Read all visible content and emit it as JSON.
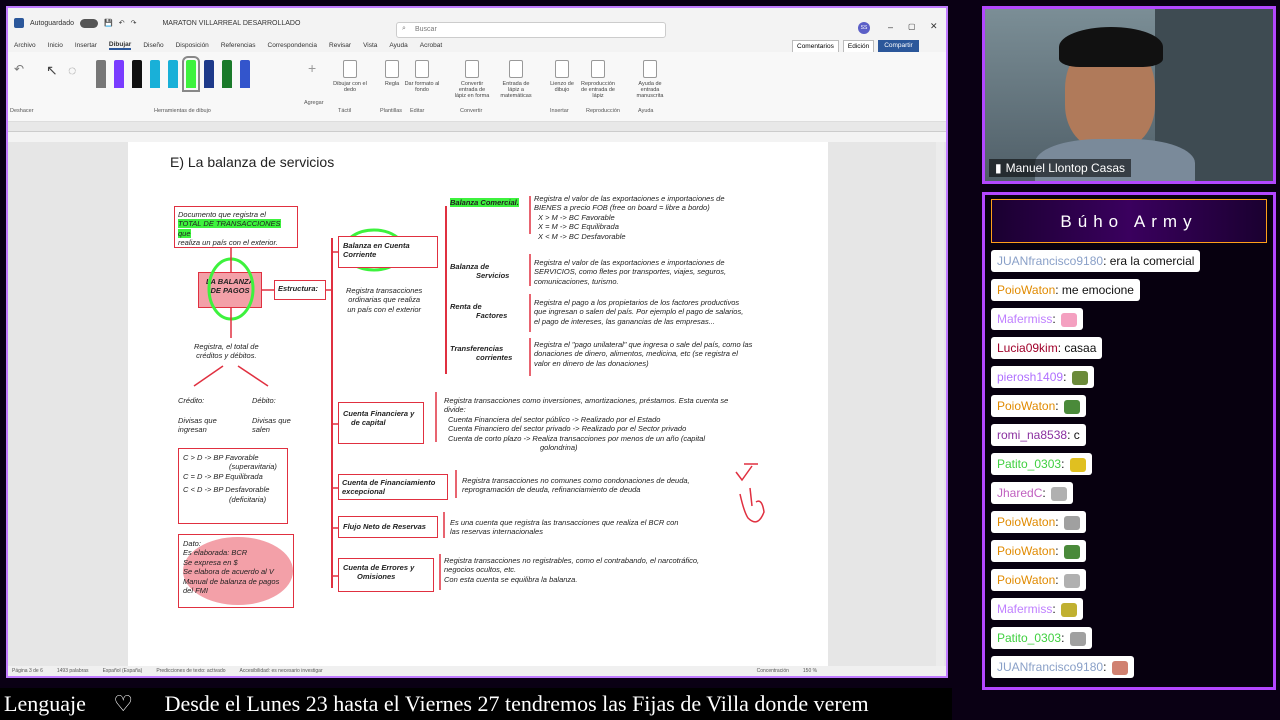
{
  "word": {
    "autosave": "Autoguardado",
    "doc_title": "MARATON VILLARREAL DESARROLLADO",
    "search_placeholder": "Buscar",
    "user_initials": "SS",
    "menu": [
      "Archivo",
      "Inicio",
      "Insertar",
      "Dibujar",
      "Diseño",
      "Disposición",
      "Referencias",
      "Correspondencia",
      "Revisar",
      "Vista",
      "Ayuda",
      "Acrobat"
    ],
    "active_menu": "Dibujar",
    "comments_btn": "Comentarios",
    "edit_btn": "Edición",
    "share_btn": "Compartir",
    "undo_label": "Deshacer",
    "draw_tools_label": "Herramientas de dibujo",
    "add_label": "Agregar",
    "ribbon_buttons": [
      {
        "label": "Dibujar con el dedo",
        "group": "Táctil"
      },
      {
        "label": "Regla",
        "group": "Plantillas"
      },
      {
        "label": "Dar formato al fondo",
        "group": "Editar"
      },
      {
        "label": "Convertir entrada de lápiz en forma",
        "group": "Convertir"
      },
      {
        "label": "Entrada de lápiz a matemáticas",
        "group": ""
      },
      {
        "label": "Lienzo de dibujo",
        "group": "Insertar"
      },
      {
        "label": "Reproducción de entrada de lápiz",
        "group": "Reproducción"
      },
      {
        "label": "Ayuda de entrada manuscrita",
        "group": "Ayuda"
      }
    ],
    "pen_colors": [
      "#777777",
      "#7a3cff",
      "#111111",
      "#19b0d8",
      "#19b0d8",
      "#3df23d",
      "#1e3a8a",
      "#1a7a2a",
      "#3355cc"
    ],
    "status": [
      "Página 3 de 6",
      "1493 palabras",
      "Español (España)",
      "Predicciones de texto: activado",
      "Accesibilidad: es necesario investigar",
      "Concentración",
      "150 %"
    ]
  },
  "doc": {
    "heading": "E) La balanza de servicios",
    "def_box": [
      "Documento que registra el",
      "TOTAL DE TRANSACCIONES que",
      "realiza un país con el exterior."
    ],
    "lbp": [
      "LA BALANZA",
      "DE PAGOS"
    ],
    "estructura": "Estructura:",
    "registra": [
      "Registra, el total de",
      "créditos y débitos."
    ],
    "credito": "Crédito:",
    "debito": "Débito:",
    "divisas_in": [
      "Divisas que",
      "ingresan"
    ],
    "divisas_out": [
      "Divisas que",
      "salen"
    ],
    "cd_rules": [
      "C > D  -> BP Favorable",
      "(superavitaria)",
      "C = D  -> BP Equilibrada",
      "C < D  -> BP Desfavorable",
      "(deficitaria)"
    ],
    "dato": [
      "Dato:",
      "Es elaborada: BCR",
      "Se expresa en $",
      "Se elabora de acuerdo al V",
      "Manual  de balanza de pagos",
      "del FMI"
    ],
    "bcc": [
      "Balanza en Cuenta",
      "Corriente"
    ],
    "bcc_desc": [
      "Registra transacciones",
      "ordinarias que realiza",
      "un país con el exterior"
    ],
    "rows": [
      {
        "label": [
          "Balanza Comercial."
        ],
        "text": [
          "Registra el valor de las exportaciones e importaciones de",
          "BIENES a precio FOB (free on board = libre a bordo)",
          "X  >  M -> BC Favorable",
          "X  =  M -> BC Equilibrada",
          "X  <  M -> BC Desfavorable"
        ]
      },
      {
        "label": [
          "Balanza de",
          "Servicios"
        ],
        "text": [
          "Registra el valor de las exportaciones e importaciones de",
          "SERVICIOS, como fletes por transportes, viajes, seguros,",
          "comunicaciones, turismo."
        ]
      },
      {
        "label": [
          "Renta de",
          "Factores"
        ],
        "text": [
          "Registra el pago a los propietarios de los factores productivos",
          "que ingresan o salen del país. Por ejemplo el pago de salarios,",
          "el pago de intereses, las ganancias de las empresas..."
        ]
      },
      {
        "label": [
          "Transferencias",
          "corrientes"
        ],
        "text": [
          "Registra el \"pago unilateral\" que ingresa o sale del país, como las",
          "donaciones de dinero, alimentos, medicina, etc (se registra el",
          "valor en dinero de las donaciones)"
        ]
      }
    ],
    "cf": [
      "Cuenta Financiera y",
      "de capital"
    ],
    "cf_text": [
      "Registra transacciones como inversiones, amortizaciones, préstamos. Esta cuenta se",
      "divide:",
      "Cuenta Financiera del sector público -> Realizado por el Estado",
      "Cuenta Financiero del sector privado -> Realizado por el Sector privado",
      "Cuenta de corto plazo -> Realiza transacciones por menos de un año (capital",
      "golondrina)"
    ],
    "cfe": [
      "Cuenta de Financiamiento",
      "excepcional"
    ],
    "cfe_text": [
      "Registra transacciones no comunes como condonaciones de deuda,",
      "reprogramación de deuda, refinanciamiento de deuda"
    ],
    "fnr": "Flujo Neto de Reservas",
    "fnr_text": [
      "Es  una cuenta que registra las transacciones que realiza el BCR con",
      "las reservas internacionales"
    ],
    "ceo": [
      "Cuenta de Errores y",
      "Omisiones"
    ],
    "ceo_text": [
      "Registra transacciones no registrables, como el contrabando, el narcotráfico,",
      "negocios ocultos, etc.",
      "Con esta cuenta se equilibra la balanza."
    ]
  },
  "camera": {
    "name": "Manuel Llontop Casas"
  },
  "chat": {
    "title": "Búho Army",
    "messages": [
      {
        "user": "JUANfrancisco9180",
        "color": "#8aa0c8",
        "text": ": era la comercial",
        "emote": ""
      },
      {
        "user": "PoioWaton",
        "color": "#e08a00",
        "text": ": me emocione",
        "emote": ""
      },
      {
        "user": "Mafermiss",
        "color": "#c080ff",
        "text": ": ",
        "emote": "#f4a0c0"
      },
      {
        "user": "Lucia09kim",
        "color": "#a0002a",
        "text": ": casaa",
        "emote": ""
      },
      {
        "user": "pierosh1409",
        "color": "#b070ff",
        "text": ": ",
        "emote": "#6b8a3a"
      },
      {
        "user": "PoioWaton",
        "color": "#e08a00",
        "text": ": ",
        "emote": "#4a8a3a"
      },
      {
        "user": "romi_na8538",
        "color": "#8a2fa0",
        "text": ": c",
        "emote": ""
      },
      {
        "user": "Patito_0303",
        "color": "#40d040",
        "text": ": ",
        "emote": "#e0c020"
      },
      {
        "user": "JharedC",
        "color": "#c060c0",
        "text": ": ",
        "emote": "#b0b0b0"
      },
      {
        "user": "PoioWaton",
        "color": "#e08a00",
        "text": ": ",
        "emote": "#a0a0a0"
      },
      {
        "user": "PoioWaton",
        "color": "#e08a00",
        "text": ": ",
        "emote": "#4a8a3a"
      },
      {
        "user": "PoioWaton",
        "color": "#e08a00",
        "text": ": ",
        "emote": "#b0b0b0"
      },
      {
        "user": "Mafermiss",
        "color": "#c080ff",
        "text": ": ",
        "emote": "#c0b030"
      },
      {
        "user": "Patito_0303",
        "color": "#40d040",
        "text": ": ",
        "emote": "#a0a0a0"
      },
      {
        "user": "JUANfrancisco9180",
        "color": "#8aa0c8",
        "text": ": ",
        "emote": "#d08070"
      }
    ]
  },
  "ticker": {
    "label": "Lenguaje",
    "heart": "♡",
    "text": "Desde el Lunes 23 hasta el Viernes 27 tendremos las Fijas de Villa donde verem"
  }
}
